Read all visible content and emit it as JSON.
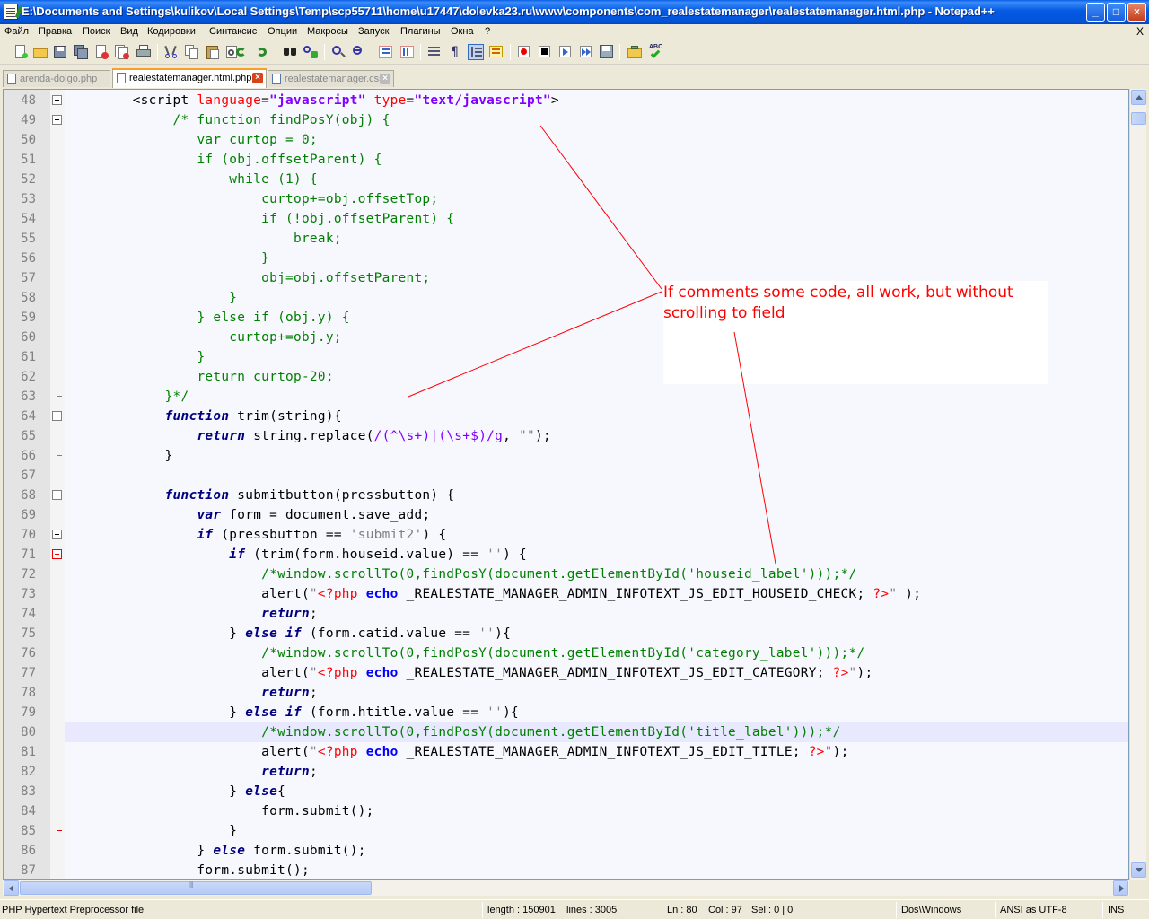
{
  "window": {
    "title": "E:\\Documents and Settings\\kulikov\\Local Settings\\Temp\\scp55711\\home\\u17447\\dolevka23.ru\\www\\components\\com_realestatemanager\\realestatemanager.html.php - Notepad++",
    "minimize_glyph": "_",
    "maximize_glyph": "□",
    "close_glyph": "×"
  },
  "menu": {
    "items": [
      "Файл",
      "Правка",
      "Поиск",
      "Вид",
      "Кодировки",
      "Синтаксис",
      "Опции",
      "Макросы",
      "Запуск",
      "Плагины",
      "Окна",
      "?"
    ],
    "close_glyph": "X"
  },
  "toolbar": {
    "icons": [
      "new-file-icon",
      "open-file-icon",
      "save-icon",
      "save-all-icon",
      "close-icon",
      "close-all-icon",
      "print-icon",
      "cut-icon",
      "copy-icon",
      "paste-icon",
      "undo-icon",
      "redo-icon",
      "find-icon",
      "replace-icon",
      "zoom-in-icon",
      "zoom-out-icon",
      "sync-vertical-icon",
      "sync-horizontal-icon",
      "word-wrap-icon",
      "show-all-chars-icon",
      "indent-guide-icon",
      "user-lang-icon",
      "record-macro-icon",
      "stop-macro-icon",
      "play-macro-icon",
      "run-macro-multiple-icon",
      "save-macro-icon",
      "tree-view-icon",
      "spellcheck-icon"
    ]
  },
  "tabs": [
    {
      "label": "arenda-dolgo.php",
      "active": false
    },
    {
      "label": "realestatemanager.html.php",
      "active": true
    },
    {
      "label": "realestatemanager.css",
      "active": false
    }
  ],
  "tab_close_glyph": "×",
  "editor": {
    "current_line": 80,
    "lines": [
      {
        "n": "48",
        "fold": "box",
        "parts": [
          [
            "dflt",
            "        "
          ],
          [
            "tag",
            "<script "
          ],
          [
            "attr",
            "language"
          ],
          [
            "tag",
            "="
          ],
          [
            "str",
            "\"javascript\""
          ],
          [
            "tag",
            " "
          ],
          [
            "attr",
            "type"
          ],
          [
            "tag",
            "="
          ],
          [
            "str",
            "\"text/javascript\""
          ],
          [
            "tag",
            ">"
          ]
        ]
      },
      {
        "n": "49",
        "fold": "box",
        "parts": [
          [
            "dflt",
            "             "
          ],
          [
            "cm",
            "/* function findPosY(obj) {"
          ]
        ]
      },
      {
        "n": "50",
        "fold": "line",
        "parts": [
          [
            "dflt",
            "                "
          ],
          [
            "cm",
            "var curtop = 0;"
          ]
        ]
      },
      {
        "n": "51",
        "fold": "line",
        "parts": [
          [
            "dflt",
            "                "
          ],
          [
            "cm",
            "if (obj.offsetParent) {"
          ]
        ]
      },
      {
        "n": "52",
        "fold": "line",
        "parts": [
          [
            "dflt",
            "                    "
          ],
          [
            "cm",
            "while (1) {"
          ]
        ]
      },
      {
        "n": "53",
        "fold": "line",
        "parts": [
          [
            "dflt",
            "                        "
          ],
          [
            "cm",
            "curtop+=obj.offsetTop;"
          ]
        ]
      },
      {
        "n": "54",
        "fold": "line",
        "parts": [
          [
            "dflt",
            "                        "
          ],
          [
            "cm",
            "if (!obj.offsetParent) {"
          ]
        ]
      },
      {
        "n": "55",
        "fold": "line",
        "parts": [
          [
            "dflt",
            "                            "
          ],
          [
            "cm",
            "break;"
          ]
        ]
      },
      {
        "n": "56",
        "fold": "line",
        "parts": [
          [
            "dflt",
            "                        "
          ],
          [
            "cm",
            "}"
          ]
        ]
      },
      {
        "n": "57",
        "fold": "line",
        "parts": [
          [
            "dflt",
            "                        "
          ],
          [
            "cm",
            "obj=obj.offsetParent;"
          ]
        ]
      },
      {
        "n": "58",
        "fold": "line",
        "parts": [
          [
            "dflt",
            "                    "
          ],
          [
            "cm",
            "}"
          ]
        ]
      },
      {
        "n": "59",
        "fold": "line",
        "parts": [
          [
            "dflt",
            "                "
          ],
          [
            "cm",
            "} else if (obj.y) {"
          ]
        ]
      },
      {
        "n": "60",
        "fold": "line",
        "parts": [
          [
            "dflt",
            "                    "
          ],
          [
            "cm",
            "curtop+=obj.y;"
          ]
        ]
      },
      {
        "n": "61",
        "fold": "line",
        "parts": [
          [
            "dflt",
            "                "
          ],
          [
            "cm",
            "}"
          ]
        ]
      },
      {
        "n": "62",
        "fold": "line",
        "parts": [
          [
            "dflt",
            "                "
          ],
          [
            "cm",
            "return curtop-20;"
          ]
        ]
      },
      {
        "n": "63",
        "fold": "end",
        "parts": [
          [
            "dflt",
            "            "
          ],
          [
            "cm",
            "}*/"
          ]
        ]
      },
      {
        "n": "64",
        "fold": "box",
        "parts": [
          [
            "dflt",
            "            "
          ],
          [
            "kw",
            "function"
          ],
          [
            "dflt",
            " trim(string){"
          ]
        ]
      },
      {
        "n": "65",
        "fold": "line",
        "parts": [
          [
            "dflt",
            "                "
          ],
          [
            "kw",
            "return"
          ],
          [
            "dflt",
            " string.replace("
          ],
          [
            "rx",
            "/(^\\s+)|(\\s+$)/g"
          ],
          [
            "dflt",
            ", "
          ],
          [
            "sq",
            "\"\""
          ],
          [
            "dflt",
            ");"
          ]
        ]
      },
      {
        "n": "66",
        "fold": "end",
        "parts": [
          [
            "dflt",
            "            }"
          ]
        ]
      },
      {
        "n": "67",
        "fold": "line",
        "parts": [
          [
            "dflt",
            ""
          ]
        ]
      },
      {
        "n": "68",
        "fold": "box",
        "parts": [
          [
            "dflt",
            "            "
          ],
          [
            "kw",
            "function"
          ],
          [
            "dflt",
            " submitbutton(pressbutton) {"
          ]
        ]
      },
      {
        "n": "69",
        "fold": "line",
        "parts": [
          [
            "dflt",
            "                "
          ],
          [
            "kw",
            "var"
          ],
          [
            "dflt",
            " form = document.save_add;"
          ]
        ]
      },
      {
        "n": "70",
        "fold": "box",
        "parts": [
          [
            "dflt",
            "                "
          ],
          [
            "kw",
            "if"
          ],
          [
            "dflt",
            " (pressbutton == "
          ],
          [
            "sq",
            "'submit2'"
          ],
          [
            "dflt",
            ") {"
          ]
        ]
      },
      {
        "n": "71",
        "fold": "boxred",
        "parts": [
          [
            "dflt",
            "                    "
          ],
          [
            "kw",
            "if"
          ],
          [
            "dflt",
            " (trim(form.houseid.value) == "
          ],
          [
            "sq",
            "''"
          ],
          [
            "dflt",
            ") {"
          ]
        ]
      },
      {
        "n": "72",
        "fold": "linered",
        "parts": [
          [
            "dflt",
            "                        "
          ],
          [
            "cm",
            "/*window.scrollTo(0,findPosY(document.getElementById('houseid_label')));*/"
          ]
        ]
      },
      {
        "n": "73",
        "fold": "linered",
        "parts": [
          [
            "dflt",
            "                        alert("
          ],
          [
            "sq",
            "\""
          ],
          [
            "php",
            "<?php"
          ],
          [
            "dflt",
            " "
          ],
          [
            "ph",
            "echo"
          ],
          [
            "dflt",
            " _REALESTATE_MANAGER_ADMIN_INFOTEXT_JS_EDIT_HOUSEID_CHECK; "
          ],
          [
            "php",
            "?>"
          ],
          [
            "sq",
            "\""
          ],
          [
            "dflt",
            " );"
          ]
        ]
      },
      {
        "n": "74",
        "fold": "linered",
        "parts": [
          [
            "dflt",
            "                        "
          ],
          [
            "kw",
            "return"
          ],
          [
            "dflt",
            ";"
          ]
        ]
      },
      {
        "n": "75",
        "fold": "linered",
        "parts": [
          [
            "dflt",
            "                    } "
          ],
          [
            "kw",
            "else if"
          ],
          [
            "dflt",
            " (form.catid.value == "
          ],
          [
            "sq",
            "''"
          ],
          [
            "dflt",
            "){"
          ]
        ]
      },
      {
        "n": "76",
        "fold": "linered",
        "parts": [
          [
            "dflt",
            "                        "
          ],
          [
            "cm",
            "/*window.scrollTo(0,findPosY(document.getElementById('category_label')));*/"
          ]
        ]
      },
      {
        "n": "77",
        "fold": "linered",
        "parts": [
          [
            "dflt",
            "                        alert("
          ],
          [
            "sq",
            "\""
          ],
          [
            "php",
            "<?php"
          ],
          [
            "dflt",
            " "
          ],
          [
            "ph",
            "echo"
          ],
          [
            "dflt",
            " _REALESTATE_MANAGER_ADMIN_INFOTEXT_JS_EDIT_CATEGORY; "
          ],
          [
            "php",
            "?>"
          ],
          [
            "sq",
            "\""
          ],
          [
            "dflt",
            ");"
          ]
        ]
      },
      {
        "n": "78",
        "fold": "linered",
        "parts": [
          [
            "dflt",
            "                        "
          ],
          [
            "kw",
            "return"
          ],
          [
            "dflt",
            ";"
          ]
        ]
      },
      {
        "n": "79",
        "fold": "linered",
        "parts": [
          [
            "dflt",
            "                    } "
          ],
          [
            "kw",
            "else if"
          ],
          [
            "dflt",
            " (form.htitle.value == "
          ],
          [
            "sq",
            "''"
          ],
          [
            "dflt",
            "){"
          ]
        ]
      },
      {
        "n": "80",
        "fold": "linered",
        "parts": [
          [
            "dflt",
            "                        "
          ],
          [
            "cm",
            "/*window.scrollTo(0,findPosY(document.getElementById('title_label')));*/"
          ]
        ]
      },
      {
        "n": "81",
        "fold": "linered",
        "parts": [
          [
            "dflt",
            "                        alert("
          ],
          [
            "sq",
            "\""
          ],
          [
            "php",
            "<?php"
          ],
          [
            "dflt",
            " "
          ],
          [
            "ph",
            "echo"
          ],
          [
            "dflt",
            " _REALESTATE_MANAGER_ADMIN_INFOTEXT_JS_EDIT_TITLE; "
          ],
          [
            "php",
            "?>"
          ],
          [
            "sq",
            "\""
          ],
          [
            "dflt",
            ");"
          ]
        ]
      },
      {
        "n": "82",
        "fold": "linered",
        "parts": [
          [
            "dflt",
            "                        "
          ],
          [
            "kw",
            "return"
          ],
          [
            "dflt",
            ";"
          ]
        ]
      },
      {
        "n": "83",
        "fold": "linered",
        "parts": [
          [
            "dflt",
            "                    } "
          ],
          [
            "kw",
            "else"
          ],
          [
            "dflt",
            "{"
          ]
        ]
      },
      {
        "n": "84",
        "fold": "linered",
        "parts": [
          [
            "dflt",
            "                        form.submit();"
          ]
        ]
      },
      {
        "n": "85",
        "fold": "endred",
        "parts": [
          [
            "dflt",
            "                    }"
          ]
        ]
      },
      {
        "n": "86",
        "fold": "line",
        "parts": [
          [
            "dflt",
            "                } "
          ],
          [
            "kw",
            "else"
          ],
          [
            "dflt",
            " form.submit();"
          ]
        ]
      },
      {
        "n": "87",
        "fold": "line",
        "parts": [
          [
            "dflt",
            "                form.submit();"
          ]
        ]
      }
    ]
  },
  "annotation": {
    "text": "If comments some code, all work, but without scrolling to field",
    "color": "#ff0000"
  },
  "statusbar": {
    "file_type": "PHP Hypertext Preprocessor file",
    "length": "length : 150901",
    "lines": "lines : 3005",
    "ln": "Ln : 80",
    "col": "Col : 97",
    "sel": "Sel : 0 | 0",
    "eol": "Dos\\Windows",
    "encoding": "ANSI as UTF-8",
    "mode": "INS"
  }
}
